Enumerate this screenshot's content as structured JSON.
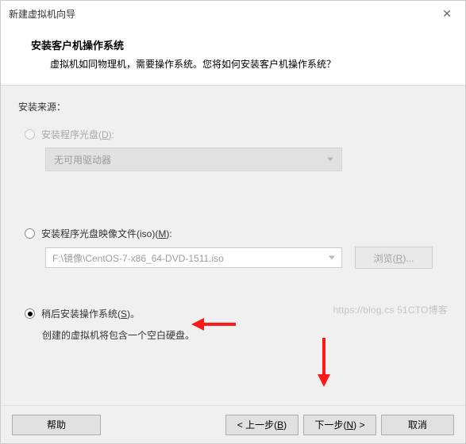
{
  "window": {
    "title": "新建虚拟机向导",
    "close_glyph": "✕"
  },
  "header": {
    "title": "安装客户机操作系统",
    "subtitle": "虚拟机如同物理机，需要操作系统。您将如何安装客户机操作系统？"
  },
  "source": {
    "label": "安装来源：",
    "disc": {
      "label_pre": "安装程序光盘(",
      "accel": "D",
      "label_post": "):",
      "dropdown_text": "无可用驱动器"
    },
    "iso": {
      "label_pre": "安装程序光盘映像文件(iso)(",
      "accel": "M",
      "label_post": "):",
      "path": "F:\\镜像\\CentOS-7-x86_64-DVD-1511.iso",
      "browse_pre": "浏览(",
      "browse_accel": "R",
      "browse_post": ")..."
    },
    "later": {
      "label_pre": "稍后安装操作系统(",
      "accel": "S",
      "label_post": ")。",
      "note": "创建的虚拟机将包含一个空白硬盘。"
    }
  },
  "footer": {
    "help": "帮助",
    "back_pre": "< 上一步(",
    "back_accel": "B",
    "back_post": ")",
    "next_pre": "下一步(",
    "next_accel": "N",
    "next_post": ") >",
    "cancel": "取消"
  },
  "watermark": "https://blog.cs    51CTO博客"
}
